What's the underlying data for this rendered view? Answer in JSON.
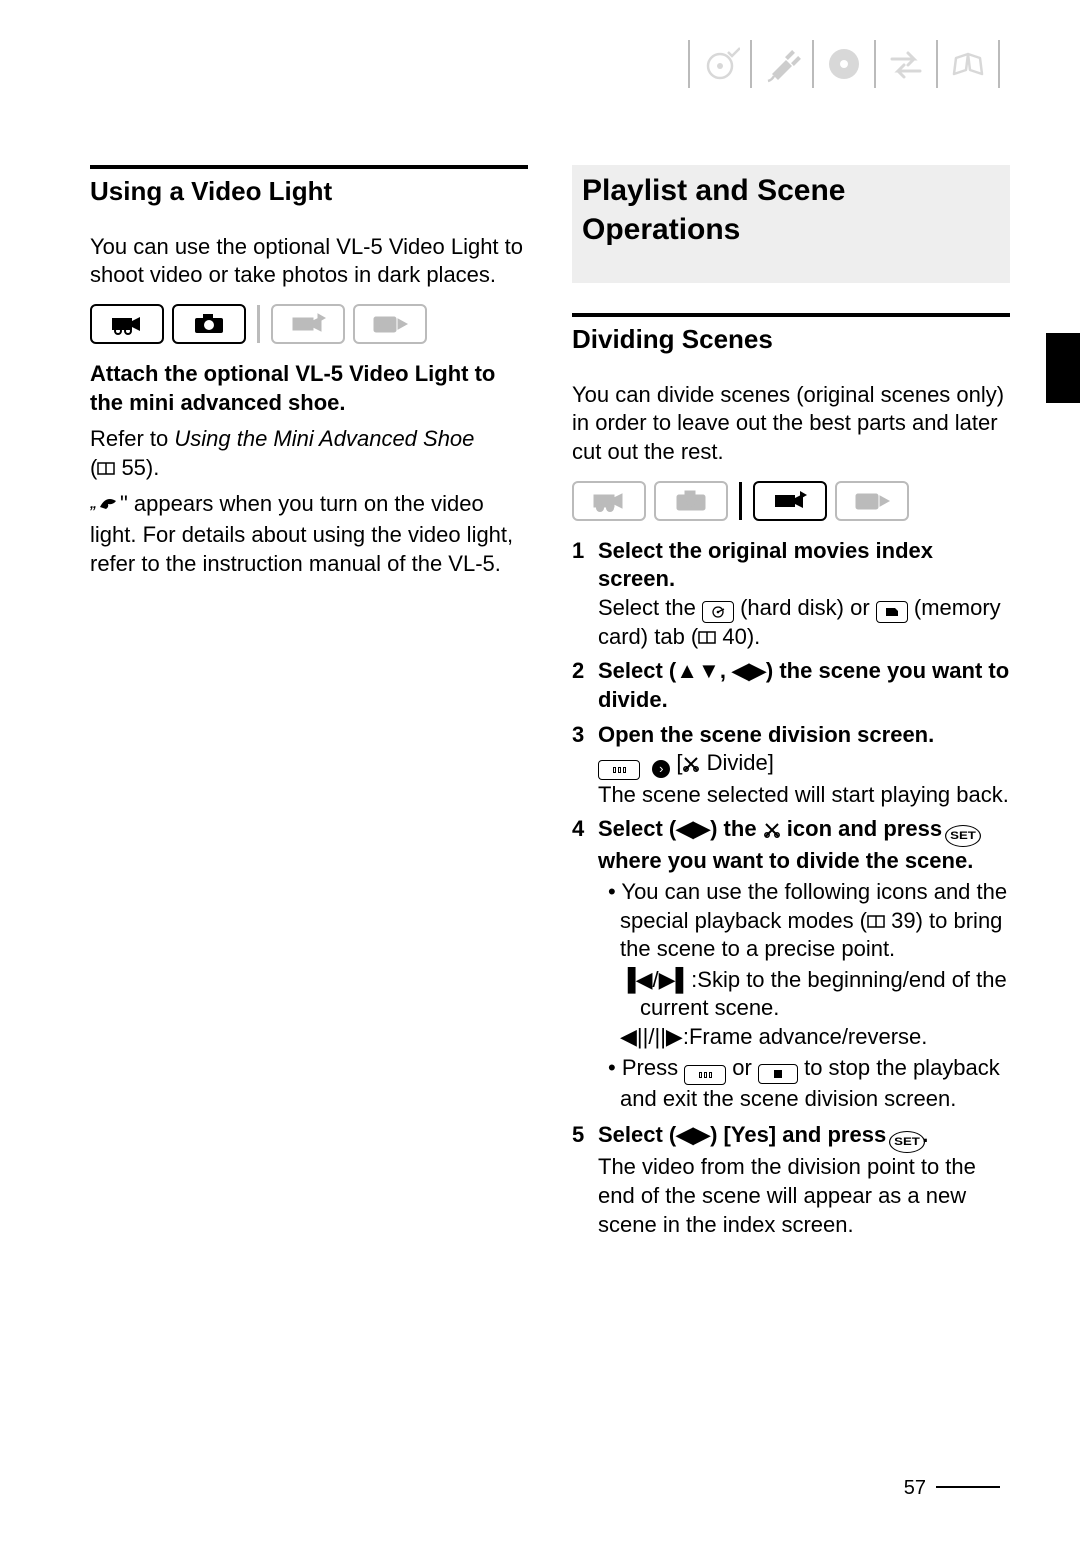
{
  "page_number": "57",
  "left": {
    "section_title": "Using a Video Light",
    "p1": "You can use the optional VL-5 Video Light to shoot video or take photos in dark places.",
    "bold1": "Attach the optional VL-5 Video Light to the mini advanced shoe.",
    "refer_prefix": "Refer to ",
    "refer_italic": "Using the Mini Advanced Shoe",
    "refer_page_open": "(",
    "refer_page_num": " 55).",
    "p3": " appears when you turn on the video light. For details about using the video light, refer to the instruction manual of the VL-5."
  },
  "right": {
    "major_title": "Playlist and Scene Operations",
    "section_title": "Dividing Scenes",
    "p1": "You can divide scenes (original scenes only) in order to leave out the best parts and later cut out the rest.",
    "s1_b": "Select the original movies index screen.",
    "s1_t_a": "Select the ",
    "s1_t_b": " (hard disk) or ",
    "s1_t_c": " (memory card) tab (",
    "s1_t_d": " 40).",
    "s2_b_a": "Select (",
    "s2_b_b": ", ",
    "s2_b_c": ") the scene you want to divide.",
    "s3_b": "Open the scene division screen.",
    "s3_t_a": " [",
    "s3_t_b": " Divide]",
    "s3_t2": "The scene selected will start playing back.",
    "s4_b_a": "Select (",
    "s4_b_b": ") the ",
    "s4_b_c": " icon and press ",
    "s4_b_d": " where you want to divide the scene.",
    "s4_bul1_a": "You can use the following icons and the special playback modes (",
    "s4_bul1_b": " 39) to bring the scene to a precise point.",
    "s4_skip": "Skip to the beginning/end of the current scene.",
    "s4_frame": "Frame advance/reverse.",
    "s4_bul2_a": "Press ",
    "s4_bul2_b": " or ",
    "s4_bul2_c": " to stop the playback and exit the scene division screen.",
    "s5_b_a": "Select (",
    "s5_b_b": ") [Yes] and press ",
    "s5_b_c": ".",
    "s5_t": "The video from the division point to the end of the scene will appear as a new scene in the index screen."
  },
  "set_label": "SET"
}
